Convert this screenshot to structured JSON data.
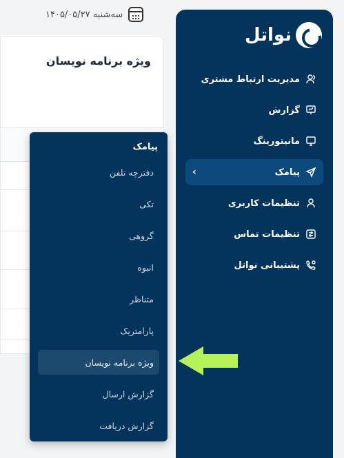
{
  "header": {
    "date": "سه‌شنبه ۱۴۰۵/۰۵/۲۷",
    "calendar_icon": "calendar-icon"
  },
  "content": {
    "title": "ویژه برنامه نویسان"
  },
  "brand": {
    "name": "نواتل",
    "logo_icon": "chat-bubble-logo-icon"
  },
  "sidebar": {
    "items": [
      {
        "label": "مدیریت ارتباط مشتری",
        "icon": "users-icon"
      },
      {
        "label": "گزارش",
        "icon": "presentation-chart-icon"
      },
      {
        "label": "مانیتورینگ",
        "icon": "monitor-icon"
      },
      {
        "label": "پیامک",
        "icon": "send-icon",
        "chevron": "›"
      },
      {
        "label": "تنظیمات کاربری",
        "icon": "user-icon"
      },
      {
        "label": "تنظیمات تماس",
        "icon": "sliders-icon"
      },
      {
        "label": "پشتیبانی نواتل",
        "icon": "support-phone-icon"
      }
    ]
  },
  "submenu": {
    "title": "پیامک",
    "items": [
      {
        "label": "دفترچه تلفن"
      },
      {
        "label": "تکی"
      },
      {
        "label": "گروهی"
      },
      {
        "label": "انبوه"
      },
      {
        "label": "متناظر"
      },
      {
        "label": "پارامتریک"
      },
      {
        "label": "ویژه برنامه نویسان"
      },
      {
        "label": "گزارش ارسال"
      },
      {
        "label": "گزارش دریافت"
      }
    ]
  },
  "colors": {
    "sidebar_bg": "#04345c",
    "active_bg": "#0c4a7d",
    "arrow": "#b6f25a"
  }
}
